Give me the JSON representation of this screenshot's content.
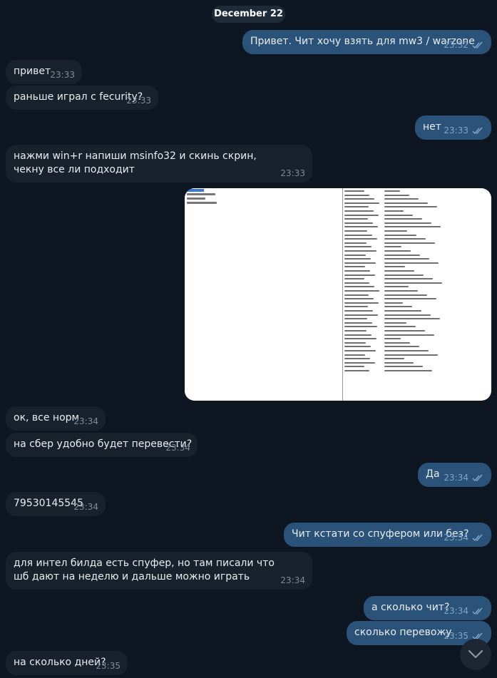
{
  "date_separator": "December 22",
  "messages": [
    {
      "dir": "out",
      "text": "Привет. Чит хочу взять для mw3 / warzone",
      "time": "23:32",
      "read": true
    },
    {
      "dir": "in",
      "text": "привет",
      "time": "23:33"
    },
    {
      "dir": "in",
      "text": "раньше играл с fecurity?",
      "time": "23:33"
    },
    {
      "dir": "out",
      "text": "нет",
      "time": "23:33",
      "read": true
    },
    {
      "dir": "in",
      "text": "нажми win+r напиши msinfo32 и скинь скрин, чекну все ли подходит",
      "time": "23:33"
    },
    {
      "dir": "in",
      "text": "ок, все норм",
      "time": "23:34"
    },
    {
      "dir": "in",
      "text": "на сбер удобно будет перевести?",
      "time": "23:34"
    },
    {
      "dir": "out",
      "text": "Да",
      "time": "23:34",
      "read": true
    },
    {
      "dir": "in",
      "text": "79530145545",
      "time": "23:34"
    },
    {
      "dir": "out",
      "text": "Чит кстати со спуфером или без?",
      "time": "23:34",
      "read": true
    },
    {
      "dir": "in",
      "text": "для интел билда есть спуфер, но там писали что шб дают на неделю и дальше можно играть",
      "time": "23:34"
    },
    {
      "dir": "out",
      "text": "а сколько чит?",
      "time": "23:34",
      "read": true
    },
    {
      "dir": "out",
      "text": "сколько перевожу",
      "time": "23:35",
      "read": true
    },
    {
      "dir": "in",
      "text": "на сколько дней?",
      "time": "23:35"
    }
  ],
  "screenshot_message": {
    "image_description": "msinfo32 system summary screenshot",
    "time": ""
  },
  "colors": {
    "background": "#0e1621",
    "incoming_bubble": "#18222d",
    "outgoing_bubble": "#2b5278",
    "meta_in": "#7d8b9a",
    "meta_out": "#7ea6c9"
  },
  "icons": {
    "read_receipt": "double-check-icon",
    "scroll_down": "chevron-down-icon"
  }
}
